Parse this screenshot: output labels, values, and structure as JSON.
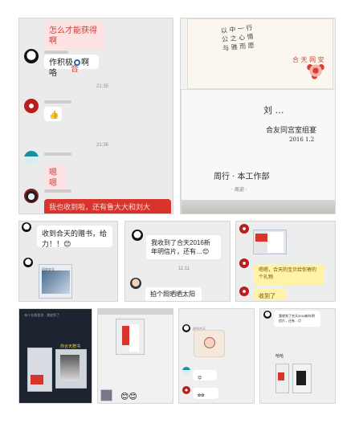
{
  "tiles": {
    "main_chat": {
      "question": "怎么才能获得啊",
      "message_1": "作积极",
      "message_1_suffix": "啊咯",
      "answer": "合",
      "time_1": "21:35",
      "time_2": "21:36",
      "thumb": "👍",
      "message_2": "嗯嗯",
      "message_3": "我也收到啦，还有鲁大大和刘大"
    },
    "letter_photo": {
      "signature_text": "刘 …",
      "signature_line": "合友同宫室组宴",
      "bottom_text": "周行 · 本工作部",
      "date": "2016 1.2"
    },
    "chat_a": {
      "text_1": "收到合天的赠书，给力！！",
      "emoji": "😊"
    },
    "chat_b": {
      "text_1": "我收到了合天2016新年明信片，还有…",
      "emoji": "😊",
      "text_2": "拍个照晒晒太阳"
    },
    "chat_c": {
      "text_1": "嗯嗯，合天的宝贝给你寄的个礼物",
      "text_2": "收到了",
      "emoji": "😊"
    },
    "dark_photo": {
      "line_1": "…",
      "label": "你合天赠书"
    },
    "chat_d": {
      "text": "我收到了合天2016新年明信片，还有…",
      "emoji": "😊"
    },
    "chat_e": {
      "line": "哈哈"
    }
  },
  "colors": {
    "accent_red": "#d8342c",
    "pink": "#ffe3e3",
    "chat_bg": "#ebebeb"
  }
}
